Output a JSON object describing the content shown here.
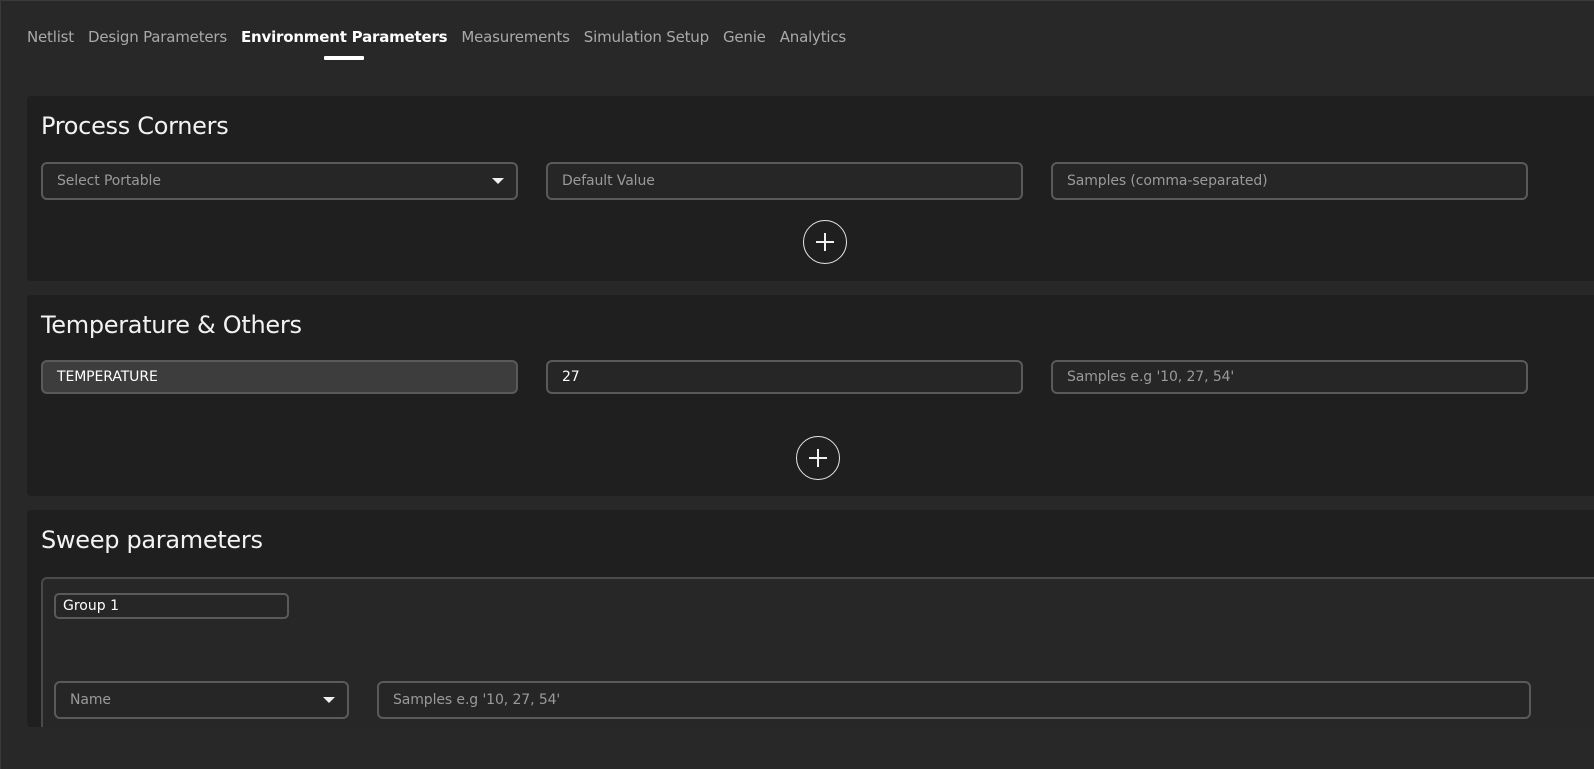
{
  "tabs": [
    {
      "label": "Netlist",
      "active": false
    },
    {
      "label": "Design Parameters",
      "active": false
    },
    {
      "label": "Environment Parameters",
      "active": true
    },
    {
      "label": "Measurements",
      "active": false
    },
    {
      "label": "Simulation Setup",
      "active": false
    },
    {
      "label": "Genie",
      "active": false
    },
    {
      "label": "Analytics",
      "active": false
    }
  ],
  "process_corners": {
    "title": "Process Corners",
    "select_placeholder": "Select Portable",
    "default_placeholder": "Default Value",
    "samples_placeholder": "Samples (comma-separated)",
    "add_icon": "plus-circle-icon"
  },
  "temperature": {
    "title": "Temperature & Others",
    "name_value": "TEMPERATURE",
    "default_value": "27",
    "samples_placeholder": "Samples e.g '10, 27, 54'",
    "add_icon": "plus-circle-icon"
  },
  "sweep": {
    "title": "Sweep parameters",
    "group_name": "Group 1",
    "name_placeholder": "Name",
    "samples_placeholder": "Samples e.g '10, 27, 54'"
  },
  "colors": {
    "background": "#282828",
    "panel": "#1f1f1f",
    "field_border": "#5a5a5a",
    "text_active": "#ffffff",
    "text_muted": "#a9a9a9"
  }
}
